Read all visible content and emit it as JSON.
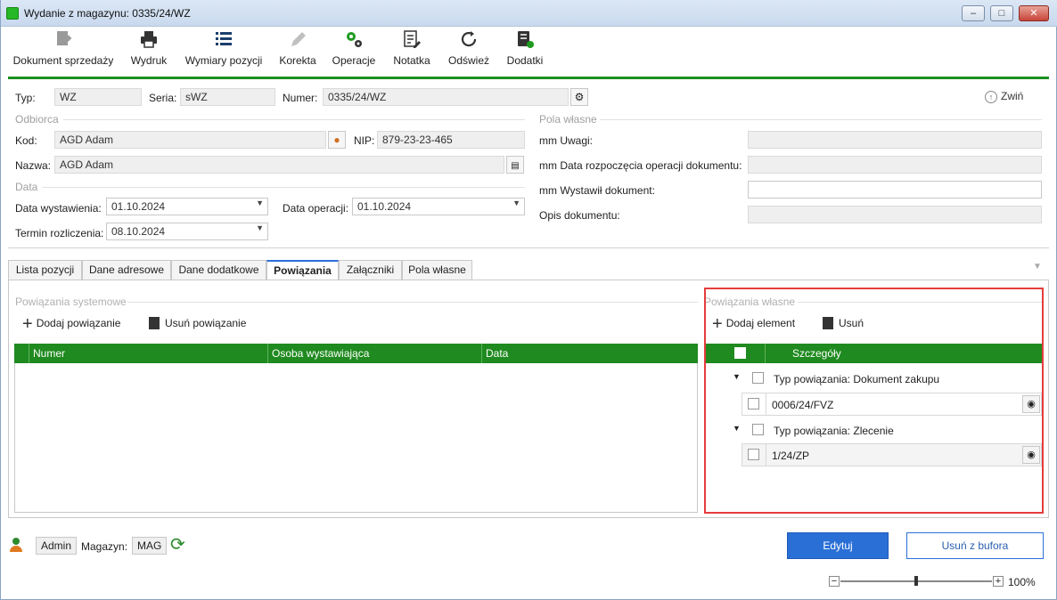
{
  "window": {
    "title": "Wydanie z magazynu: 0335/24/WZ"
  },
  "toolbar": {
    "items": [
      {
        "label": "Dokument sprzedaży",
        "icon": "document-arrow-icon"
      },
      {
        "label": "Wydruk",
        "icon": "printer-icon"
      },
      {
        "label": "Wymiary pozycji",
        "icon": "list-icon"
      },
      {
        "label": "Korekta",
        "icon": "pencil-icon"
      },
      {
        "label": "Operacje",
        "icon": "gears-icon"
      },
      {
        "label": "Notatka",
        "icon": "note-icon"
      },
      {
        "label": "Odśwież",
        "icon": "refresh-icon"
      },
      {
        "label": "Dodatki",
        "icon": "addons-icon"
      }
    ]
  },
  "header": {
    "typ_label": "Typ:",
    "typ_value": "WZ",
    "seria_label": "Seria:",
    "seria_value": "sWZ",
    "numer_label": "Numer:",
    "numer_value": "0335/24/WZ",
    "collapse_label": "Zwiń"
  },
  "odbiorca": {
    "section": "Odbiorca",
    "kod_label": "Kod:",
    "kod_value": "AGD Adam",
    "nip_label": "NIP:",
    "nip_value": "879-23-23-465",
    "nazwa_label": "Nazwa:",
    "nazwa_value": "AGD Adam"
  },
  "data": {
    "section": "Data",
    "wyst_label": "Data wystawienia:",
    "wyst_value": "01.10.2024",
    "oper_label": "Data operacji:",
    "oper_value": "01.10.2024",
    "termin_label": "Termin rozliczenia:",
    "termin_value": "08.10.2024"
  },
  "pola": {
    "section": "Pola własne",
    "uwagi_label": "mm Uwagi:",
    "rozp_label": "mm Data rozpoczęcia operacji dokumentu:",
    "wystawil_label": "mm Wystawił dokument:",
    "opis_label": "Opis dokumentu:"
  },
  "tabs": [
    "Lista pozycji",
    "Dane adresowe",
    "Dane dodatkowe",
    "Powiązania",
    "Załączniki",
    "Pola własne"
  ],
  "system": {
    "section": "Powiązania systemowe",
    "add_label": "Dodaj powiązanie",
    "remove_label": "Usuń powiązanie",
    "columns": [
      "Numer",
      "Osoba wystawiająca",
      "Data"
    ]
  },
  "own": {
    "section": "Powiązania własne",
    "add_label": "Dodaj element",
    "remove_label": "Usuń",
    "column": "Szczegóły",
    "groups": [
      {
        "title": "Typ powiązania: Dokument zakupu",
        "item": "0006/24/FVZ"
      },
      {
        "title": "Typ powiązania: Zlecenie",
        "item": "1/24/ZP"
      }
    ]
  },
  "footer": {
    "user": "Admin",
    "magazyn_label": "Magazyn:",
    "magazyn_value": "MAG",
    "edit_label": "Edytuj",
    "remove_label": "Usuń z bufora",
    "zoom": "100%"
  },
  "colors": {
    "accent_green": "#1f8a1f",
    "primary_blue": "#2a6fd6",
    "highlight_red": "#e43c3c"
  }
}
